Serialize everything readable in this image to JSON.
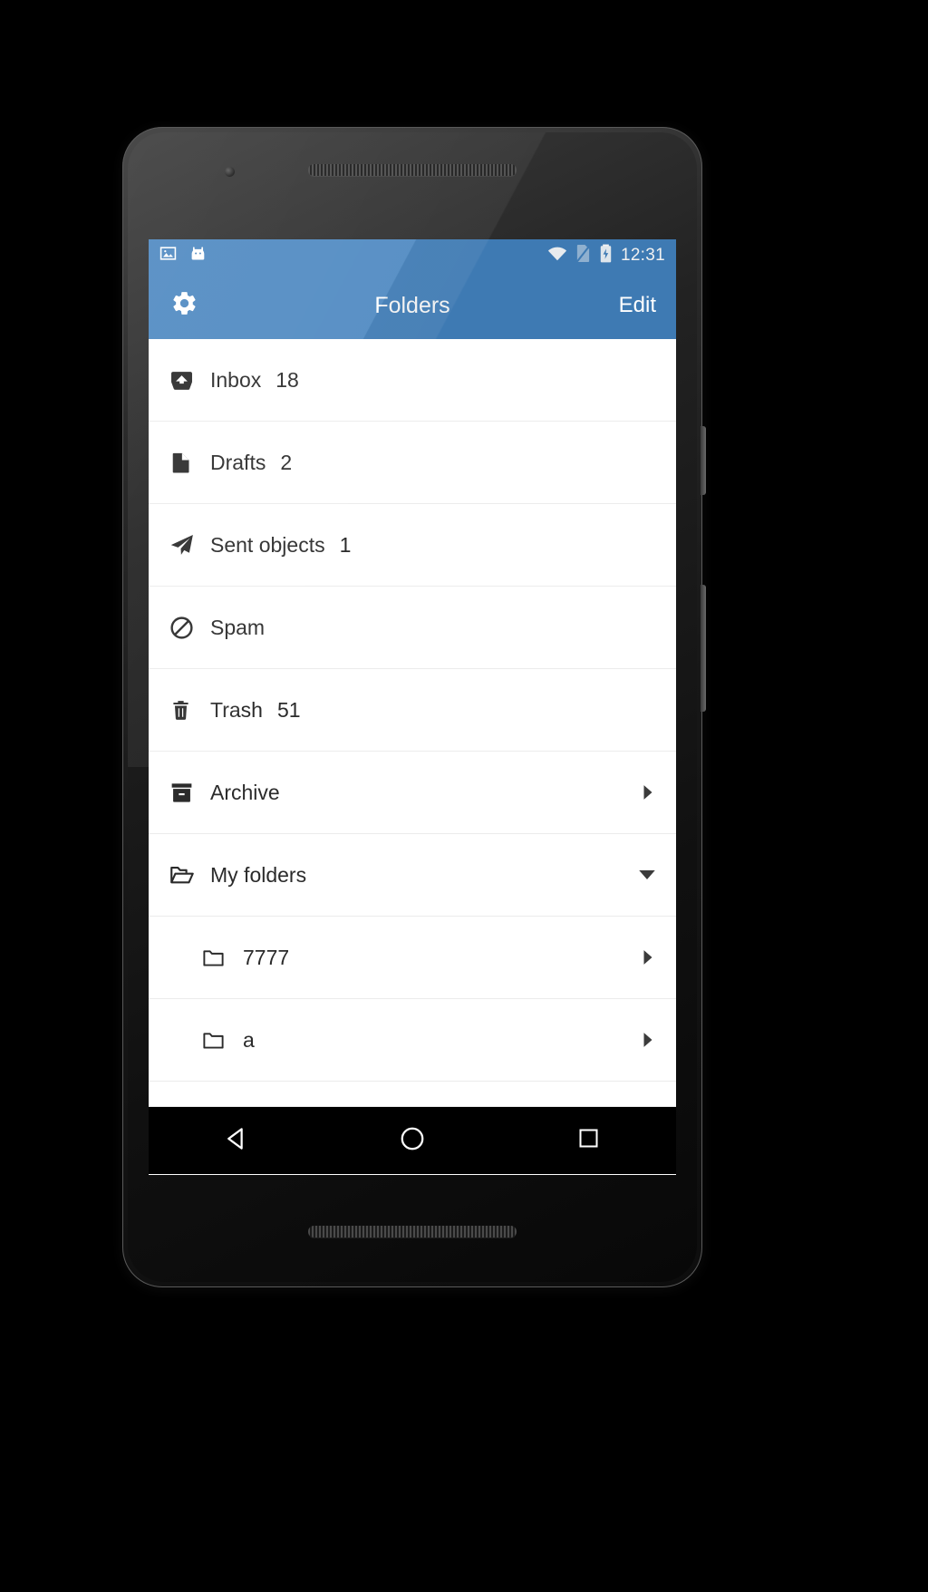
{
  "device": {
    "name": "android-phone-mockup"
  },
  "statusbar": {
    "time": "12:31",
    "icons_left": [
      "image-icon",
      "android-head-icon"
    ],
    "icons_right": [
      "wifi-icon",
      "no-sim-icon",
      "battery-charging-icon"
    ]
  },
  "toolbar": {
    "settings_icon": "gear-icon",
    "title": "Folders",
    "edit_label": "Edit",
    "background_color": "#4281bd"
  },
  "folders": [
    {
      "icon": "inbox-icon",
      "label": "Inbox",
      "count": "18",
      "chevron": ""
    },
    {
      "icon": "document-icon",
      "label": "Drafts",
      "count": "2",
      "chevron": ""
    },
    {
      "icon": "paper-plane-icon",
      "label": "Sent objects",
      "count": "1",
      "chevron": ""
    },
    {
      "icon": "block-icon",
      "label": "Spam",
      "count": "",
      "chevron": ""
    },
    {
      "icon": "trash-icon",
      "label": "Trash",
      "count": "51",
      "chevron": ""
    },
    {
      "icon": "archive-box-icon",
      "label": "Archive",
      "count": "",
      "chevron": "right"
    },
    {
      "icon": "open-folder-icon",
      "label": "My folders",
      "count": "",
      "chevron": "down"
    }
  ],
  "subfolders": [
    {
      "icon": "folder-icon",
      "label": "7777",
      "chevron": "right"
    },
    {
      "icon": "folder-icon",
      "label": "a",
      "chevron": "right"
    }
  ],
  "navbar": {
    "back_label": "back-button",
    "home_label": "home-button",
    "recents_label": "recents-button"
  }
}
